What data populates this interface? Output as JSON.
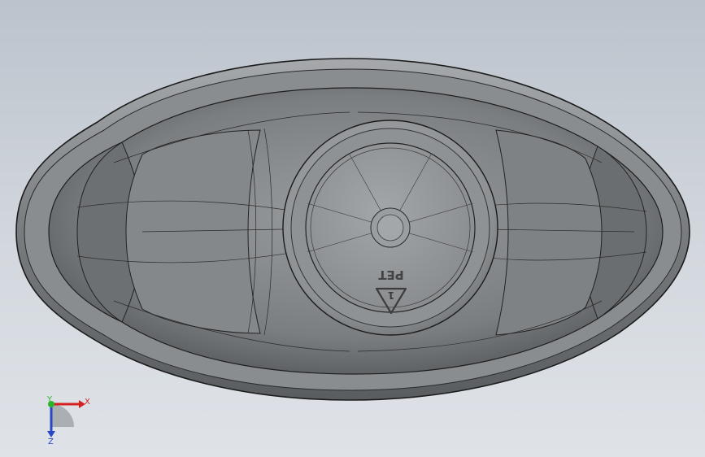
{
  "viewport": {
    "background_top": "#bcc3cc",
    "background_bottom": "#dfe3e8"
  },
  "model": {
    "name": "bottle-bottom-view",
    "body_color": "#7c7f82",
    "edge_color": "#1b1b1b",
    "recycle_mark_text": "PET"
  },
  "triad": {
    "x_label": "X",
    "y_label": "Y",
    "z_label": "Z",
    "x_color": "#d42020",
    "y_color": "#2ab52a",
    "z_color": "#2848c8"
  }
}
